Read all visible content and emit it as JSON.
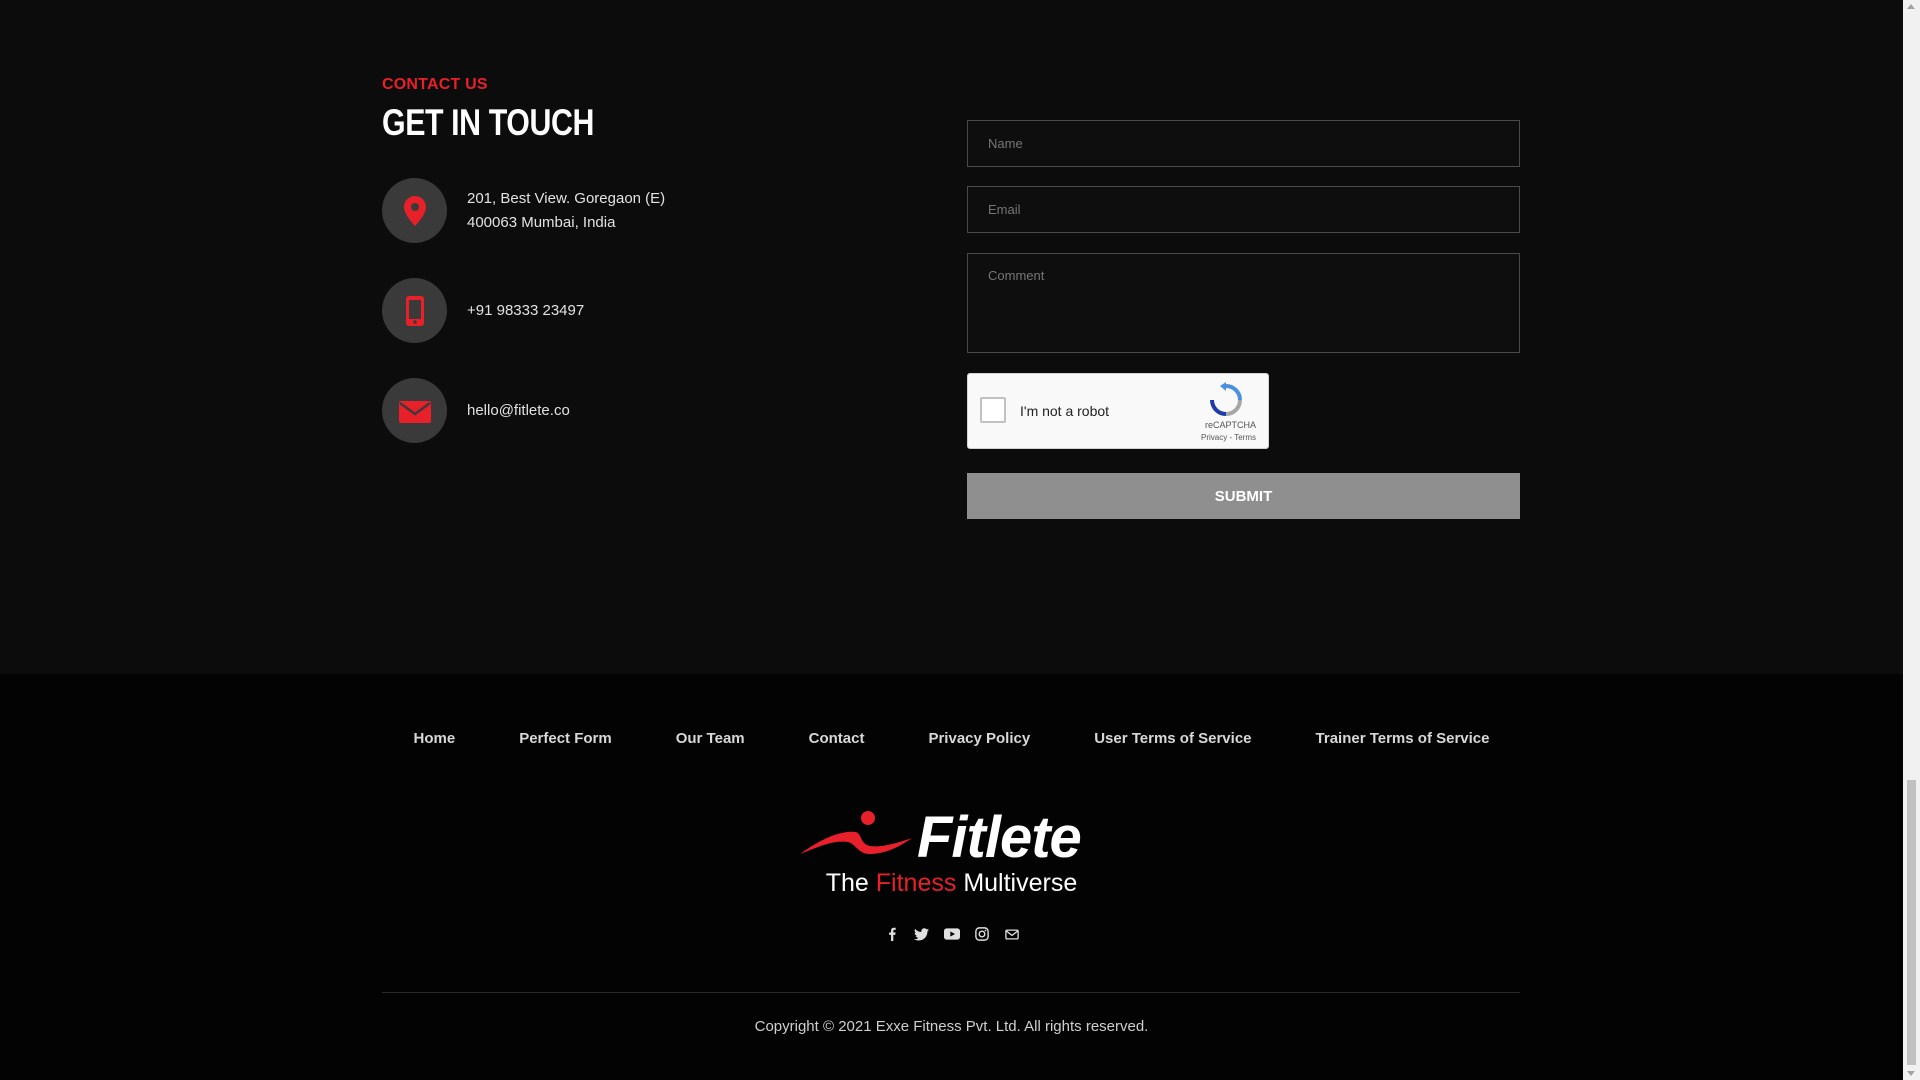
{
  "contact": {
    "eyebrow": "CONTACT US",
    "heading": "GET IN TOUCH",
    "address_line1": "201, Best View. Goregaon (E)",
    "address_line2": "400063 Mumbai, India",
    "phone": "+91 98333 23497",
    "email": "hello@fitlete.co"
  },
  "form": {
    "name_placeholder": "Name",
    "email_placeholder": "Email",
    "comment_placeholder": "Comment",
    "captcha_label": "I'm not a robot",
    "captcha_brand": "reCAPTCHA",
    "captcha_links": "Privacy - Terms",
    "submit_label": "SUBMIT"
  },
  "footer": {
    "nav": [
      "Home",
      "Perfect Form",
      "Our Team",
      "Contact",
      "Privacy Policy",
      "User Terms of Service",
      "Trainer Terms of Service"
    ],
    "logo_text": "Fitlete",
    "tagline_pre": "The",
    "tagline_accent": "Fitness",
    "tagline_post": "Multiverse",
    "social_icons": [
      "facebook-icon",
      "twitter-icon",
      "youtube-icon",
      "instagram-icon",
      "mail-icon"
    ],
    "copyright": "Copyright © 2021 Exxe Fitness Pvt. Ltd. All rights reserved."
  },
  "colors": {
    "accent": "#e8202a",
    "background": "#0c0c0c",
    "footer_background": "#030303",
    "submit_background": "#8f8f8f"
  }
}
